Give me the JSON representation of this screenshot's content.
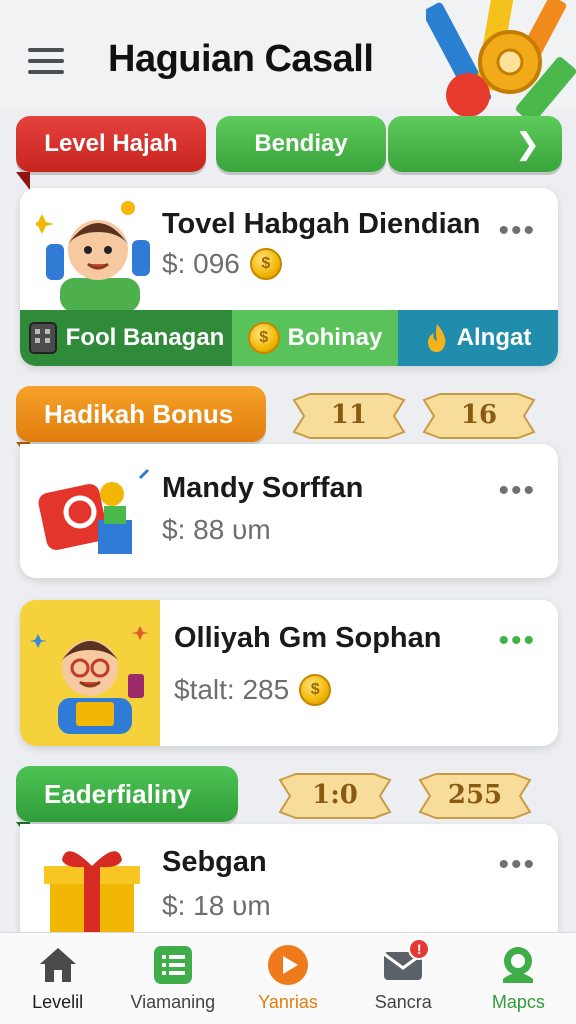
{
  "header": {
    "title": "Haguian Casall",
    "menu_icon": "hamburger-menu-icon",
    "art_icon": "pencils-gear-illustration"
  },
  "tabs": [
    {
      "label": "Level Hajah",
      "color": "#d8322d"
    },
    {
      "label": "Bendiay",
      "color": "#4cb94c"
    },
    {
      "label": "",
      "icon": "chevron-right-icon",
      "color": "#4cb94c"
    }
  ],
  "card1": {
    "title": "Tovel Habgah Diendian",
    "price": "$: 096",
    "avatar": "boy-with-headphones-avatar",
    "actions": [
      {
        "label": "Fool Banagan",
        "icon": "calculator-icon",
        "color": "#2f8a3a"
      },
      {
        "label": "Bohinay",
        "icon": "coin-icon",
        "color": "#5ac25a"
      },
      {
        "label": "Alngat",
        "icon": "flame-icon",
        "color": "#1f8dab"
      }
    ]
  },
  "section1": {
    "label": "Hadikah Bonus",
    "banners": [
      "11",
      "16"
    ]
  },
  "card2": {
    "title": "Mandy Sorffan",
    "price": "$: 88 υm",
    "icon": "red-box-blocks-icon"
  },
  "card3": {
    "title": "Olliyah Gm Sophan",
    "price": "$talt: 285",
    "avatar": "boy-with-glasses-avatar",
    "bg_color": "#f5d13c"
  },
  "section2": {
    "label": "Eaderfialiny",
    "banners": [
      "1:0",
      "255"
    ]
  },
  "card4": {
    "title": "Sebgan",
    "price": "$: 18 υm",
    "icon": "gift-box-icon"
  },
  "nav": [
    {
      "label": "Levelil",
      "icon": "home-icon",
      "color": "#1c1c1c",
      "active": true
    },
    {
      "label": "Viamaning",
      "icon": "list-icon",
      "color": "#444444"
    },
    {
      "label": "Yanrias",
      "icon": "play-icon",
      "color": "#e07d0c"
    },
    {
      "label": "Sancra",
      "icon": "mail-icon",
      "color": "#444444",
      "badge": "!"
    },
    {
      "label": "Mapcs",
      "icon": "map-pin-icon",
      "color": "#2f9d39"
    }
  ]
}
